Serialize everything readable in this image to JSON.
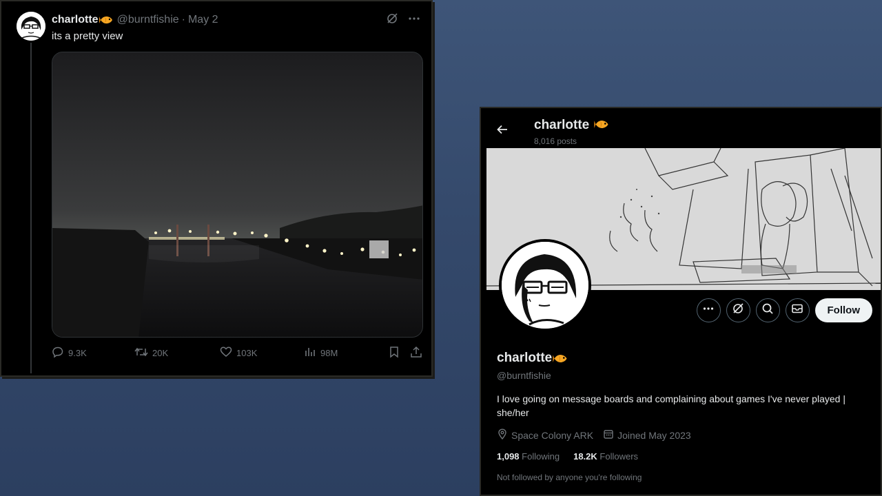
{
  "tweet": {
    "author_name": "charlotte",
    "handle": "@burntfishie",
    "separator": "·",
    "date": "May 2",
    "text": "its a pretty view",
    "actions": {
      "replies": "9.3K",
      "reposts": "20K",
      "likes": "103K",
      "views": "98M"
    },
    "icons": [
      "grok-icon",
      "more-icon",
      "reply-icon",
      "repost-icon",
      "like-icon",
      "views-icon",
      "bookmark-icon",
      "share-icon"
    ]
  },
  "profile": {
    "topbar_name": "charlotte",
    "post_count": "8,016 posts",
    "name": "charlotte",
    "handle": "@burntfishie",
    "bio": "I love going on message boards and complaining about games I've never played | she/her",
    "location": "Space Colony ARK",
    "joined": "Joined May 2023",
    "following_count": "1,098",
    "following_label": "Following",
    "followers_count": "18.2K",
    "followers_label": "Followers",
    "follow_note": "Not followed by anyone you're following",
    "follow_button": "Follow"
  },
  "colors": {
    "background": "#3e5578",
    "panel": "#000000",
    "text_primary": "#e7e9ea",
    "text_secondary": "#71767b",
    "fish": "#f6a623"
  }
}
